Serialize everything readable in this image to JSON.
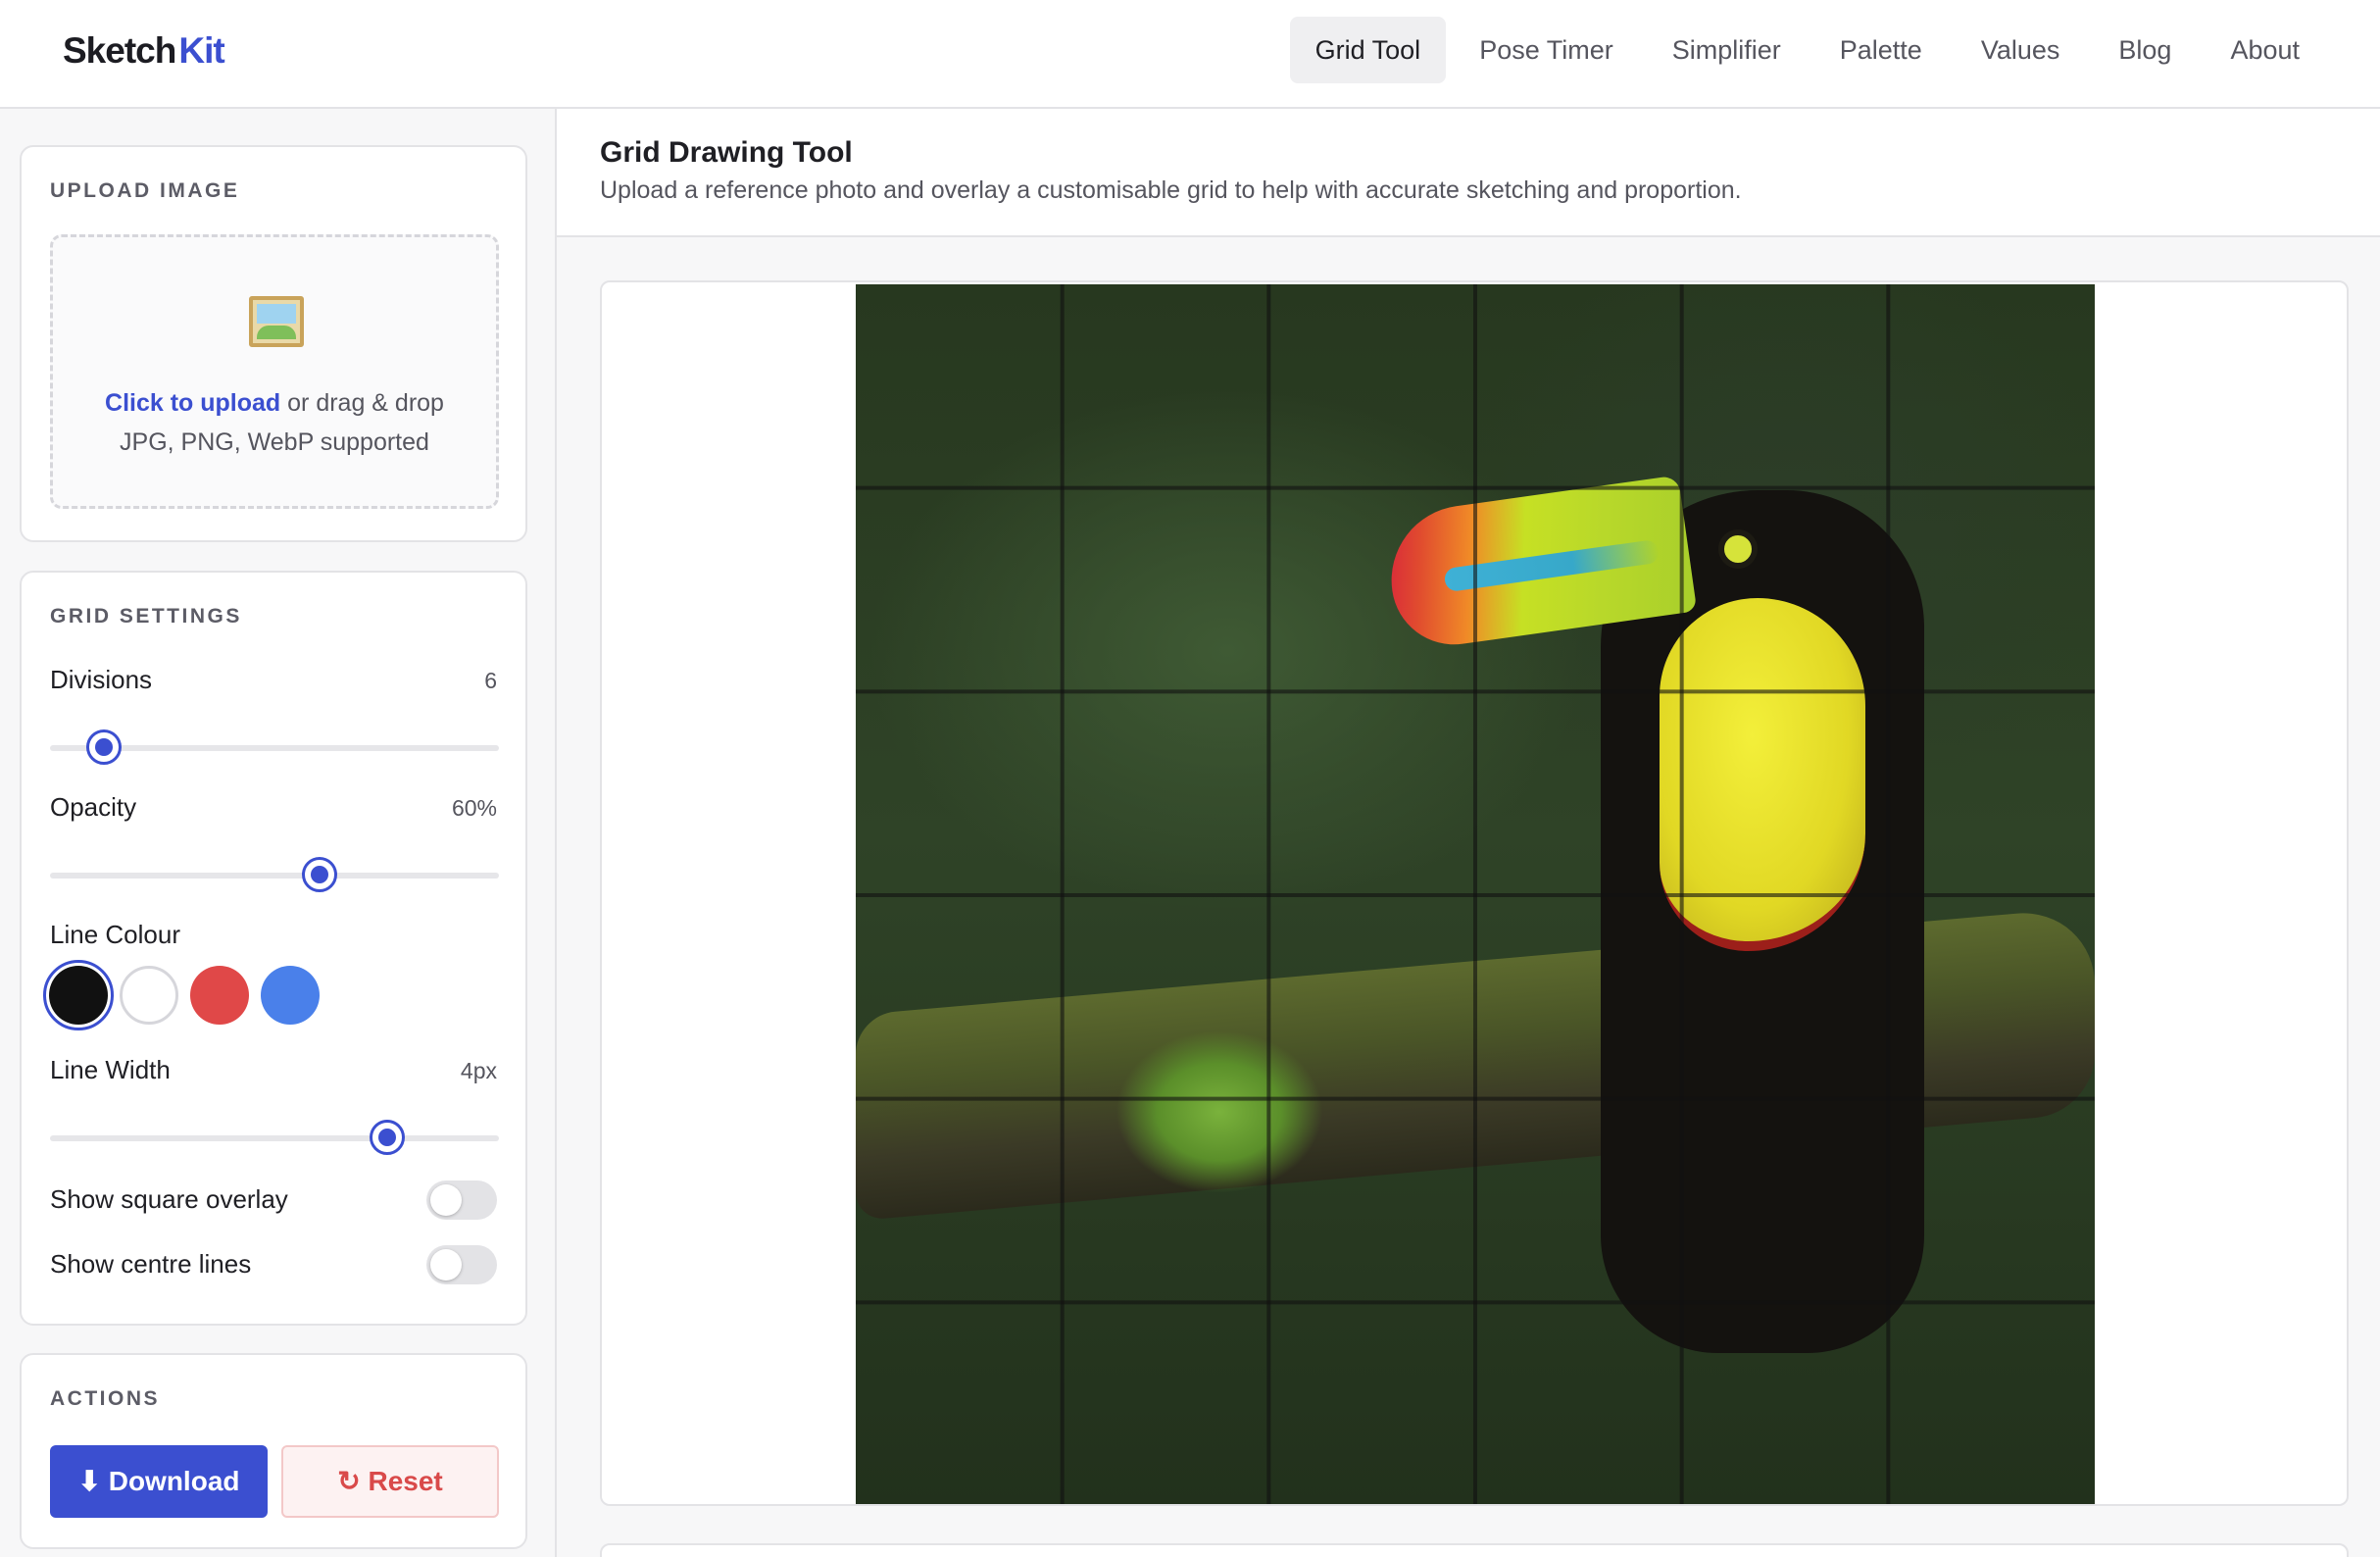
{
  "brand": {
    "part1": "Sketch",
    "part2": "Kit",
    "accent": "#3b4fd0"
  },
  "nav": {
    "items": [
      {
        "label": "Grid Tool",
        "active": true
      },
      {
        "label": "Pose Timer"
      },
      {
        "label": "Simplifier"
      },
      {
        "label": "Palette"
      },
      {
        "label": "Values"
      },
      {
        "label": "Blog"
      },
      {
        "label": "About"
      }
    ]
  },
  "upload": {
    "title": "UPLOAD IMAGE",
    "icon": "framed-picture-icon",
    "link": "Click to upload",
    "rest": " or drag & drop",
    "formats": "JPG, PNG, WebP supported"
  },
  "grid_settings": {
    "title": "GRID SETTINGS",
    "divisions": {
      "label": "Divisions",
      "value": "6",
      "level": 0.12
    },
    "opacity": {
      "label": "Opacity",
      "value": "60%",
      "level": 0.6
    },
    "line_colour": {
      "label": "Line Colour",
      "options": [
        "#111111",
        "#ffffff",
        "#e04848",
        "#4a80ea"
      ],
      "selected": 0
    },
    "line_width": {
      "label": "Line Width",
      "value": "4px",
      "level": 0.75
    },
    "square_overlay": {
      "label": "Show square overlay",
      "on": false
    },
    "centre_lines": {
      "label": "Show centre lines",
      "on": false
    }
  },
  "actions": {
    "title": "ACTIONS",
    "download": "⬇ Download",
    "reset": "↻ Reset"
  },
  "main": {
    "title": "Grid Drawing Tool",
    "subtitle": "Upload a reference photo and overlay a customisable grid to help with accurate sketching and proportion."
  },
  "canvas": {
    "grid_divisions": 6,
    "grid_color": "#111111"
  }
}
